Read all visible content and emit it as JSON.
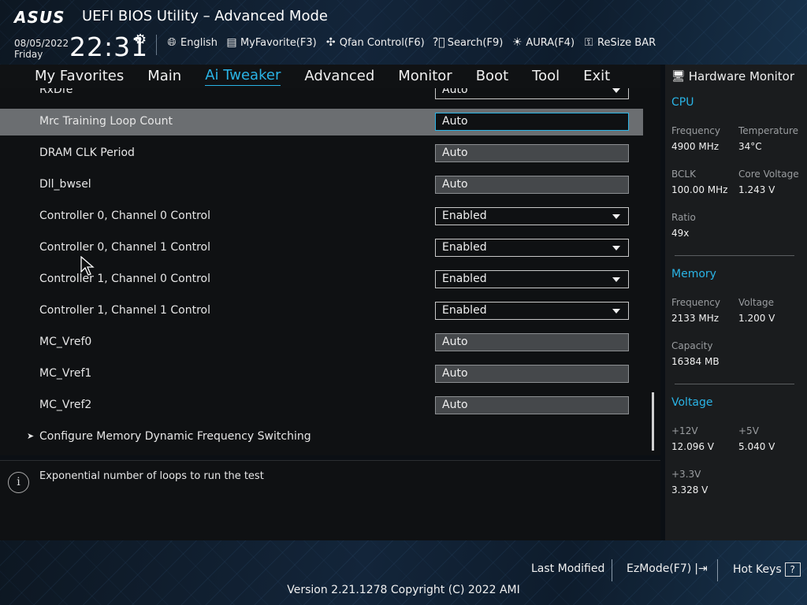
{
  "header": {
    "logo": "ASUS",
    "title": "UEFI BIOS Utility – Advanced Mode",
    "date": "08/05/2022",
    "day": "Friday",
    "time": "22:31",
    "tools": [
      {
        "icon": "globe-icon",
        "label": "English"
      },
      {
        "icon": "favorite-icon",
        "label": "MyFavorite(F3)"
      },
      {
        "icon": "fan-icon",
        "label": "Qfan Control(F6)"
      },
      {
        "icon": "search-icon",
        "label": "Search(F9)"
      },
      {
        "icon": "aura-icon",
        "label": "AURA(F4)"
      },
      {
        "icon": "resize-bar-icon",
        "label": "ReSize BAR"
      }
    ]
  },
  "menu": {
    "items": [
      "My Favorites",
      "Main",
      "Ai Tweaker",
      "Advanced",
      "Monitor",
      "Boot",
      "Tool",
      "Exit"
    ],
    "active": "Ai Tweaker"
  },
  "settings": {
    "partial_row": {
      "label": "RxDfe",
      "value": "Auto"
    },
    "rows": [
      {
        "label": "Mrc Training Loop Count",
        "value": "Auto",
        "type": "text",
        "selected": true
      },
      {
        "label": "DRAM CLK Period",
        "value": "Auto",
        "type": "text"
      },
      {
        "label": "Dll_bwsel",
        "value": "Auto",
        "type": "text"
      },
      {
        "label": "Controller 0, Channel 0 Control",
        "value": "Enabled",
        "type": "dropdown"
      },
      {
        "label": "Controller 0, Channel 1 Control",
        "value": "Enabled",
        "type": "dropdown"
      },
      {
        "label": "Controller 1, Channel 0 Control",
        "value": "Enabled",
        "type": "dropdown"
      },
      {
        "label": "Controller 1, Channel 1 Control",
        "value": "Enabled",
        "type": "dropdown"
      },
      {
        "label": "MC_Vref0",
        "value": "Auto",
        "type": "text"
      },
      {
        "label": "MC_Vref1",
        "value": "Auto",
        "type": "text"
      },
      {
        "label": "MC_Vref2",
        "value": "Auto",
        "type": "text"
      }
    ],
    "submenu": "Configure Memory Dynamic Frequency Switching"
  },
  "help": {
    "text": "Exponential number of loops to run the test"
  },
  "hardware_monitor": {
    "title": "Hardware Monitor",
    "cpu": {
      "heading": "CPU",
      "frequency_label": "Frequency",
      "frequency": "4900 MHz",
      "temperature_label": "Temperature",
      "temperature": "34°C",
      "bclk_label": "BCLK",
      "bclk": "100.00 MHz",
      "core_voltage_label": "Core Voltage",
      "core_voltage": "1.243 V",
      "ratio_label": "Ratio",
      "ratio": "49x"
    },
    "memory": {
      "heading": "Memory",
      "frequency_label": "Frequency",
      "frequency": "2133 MHz",
      "voltage_label": "Voltage",
      "voltage": "1.200 V",
      "capacity_label": "Capacity",
      "capacity": "16384 MB"
    },
    "voltage": {
      "heading": "Voltage",
      "v12_label": "+12V",
      "v12": "12.096 V",
      "v5_label": "+5V",
      "v5": "5.040 V",
      "v33_label": "+3.3V",
      "v33": "3.328 V"
    }
  },
  "footer": {
    "last_modified": "Last Modified",
    "ezmode": "EzMode(F7)",
    "hotkeys": "Hot Keys",
    "hotkeys_key": "?",
    "version": "Version 2.21.1278 Copyright (C) 2022 AMI"
  }
}
